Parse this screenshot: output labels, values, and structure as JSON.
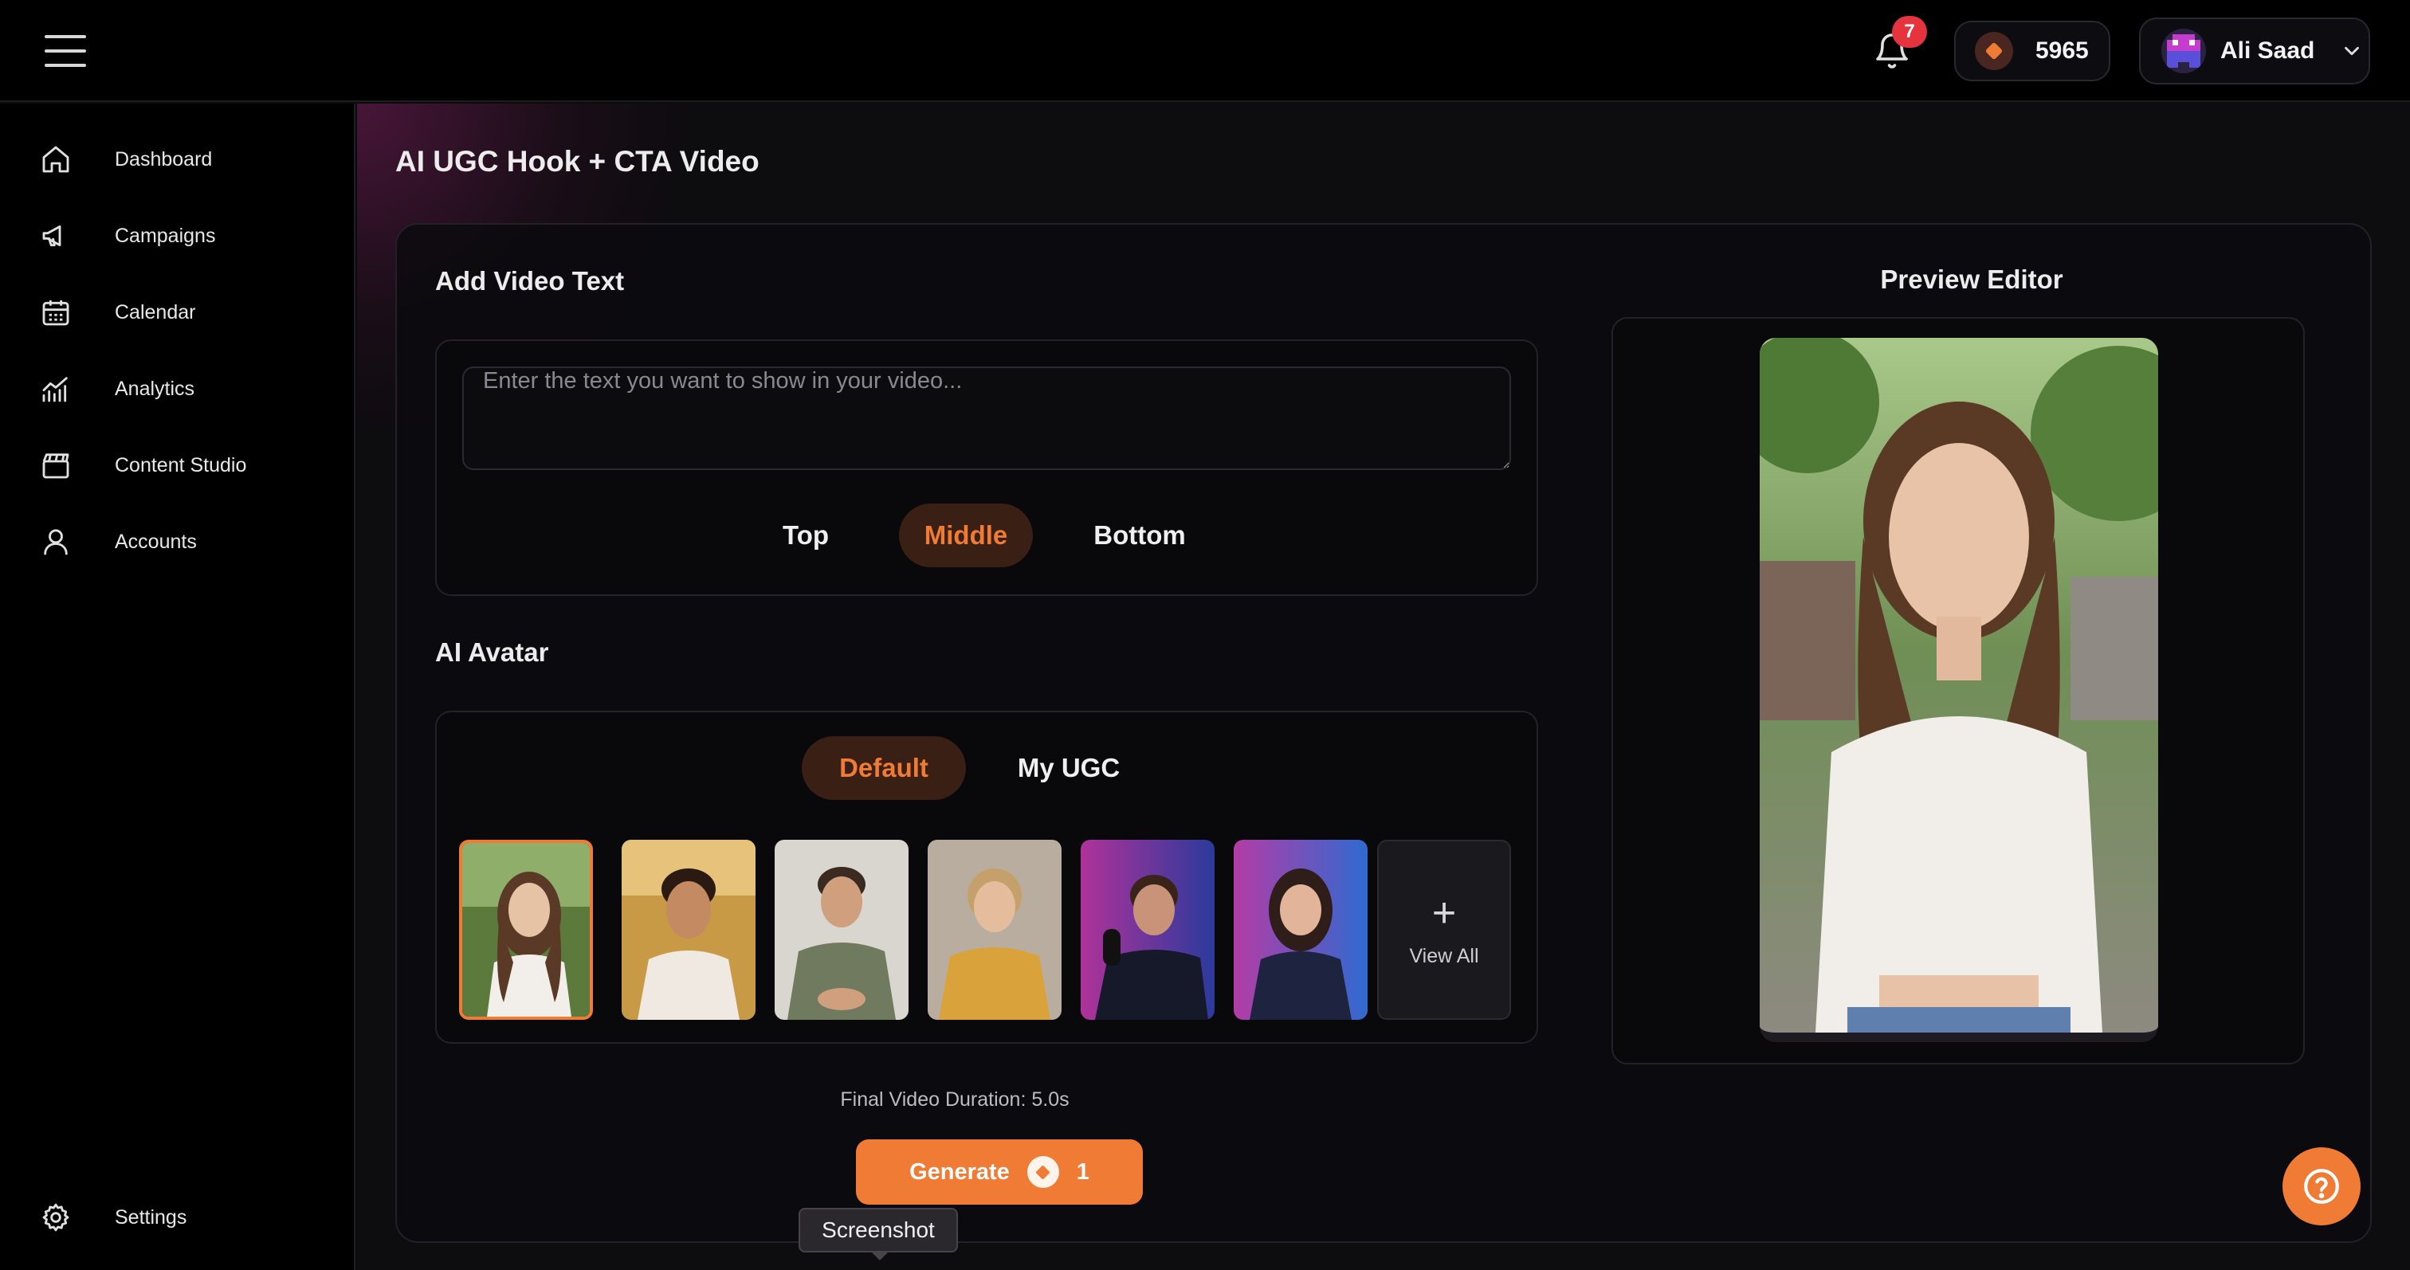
{
  "topbar": {
    "menu_icon": "hamburger-menu-icon",
    "notifications_count": "7",
    "credits": "5965",
    "user_name": "Ali Saad"
  },
  "sidebar": {
    "items": [
      {
        "label": "Dashboard",
        "icon": "home-icon"
      },
      {
        "label": "Campaigns",
        "icon": "megaphone-icon"
      },
      {
        "label": "Calendar",
        "icon": "calendar-icon"
      },
      {
        "label": "Analytics",
        "icon": "analytics-icon"
      },
      {
        "label": "Content Studio",
        "icon": "clapperboard-icon"
      },
      {
        "label": "Accounts",
        "icon": "user-icon"
      }
    ],
    "settings_label": "Settings"
  },
  "main": {
    "page_title": "AI UGC Hook + CTA Video",
    "video_text": {
      "title": "Add Video Text",
      "placeholder": "Enter the text you want to show in your video...",
      "value": "",
      "positions": [
        "Top",
        "Middle",
        "Bottom"
      ],
      "selected_position": "Middle"
    },
    "avatar": {
      "title": "AI Avatar",
      "tabs": [
        "Default",
        "My UGC"
      ],
      "selected_tab": "Default",
      "view_all_label": "View All",
      "selected_index": 0
    },
    "duration_text": "Final Video Duration: 5.0s",
    "generate": {
      "label": "Generate",
      "cost": "1"
    },
    "tooltip": "Screenshot",
    "preview_title": "Preview Editor"
  },
  "colors": {
    "accent": "#ef7b35",
    "badge": "#e5343d",
    "background": "#0b0a0d"
  }
}
